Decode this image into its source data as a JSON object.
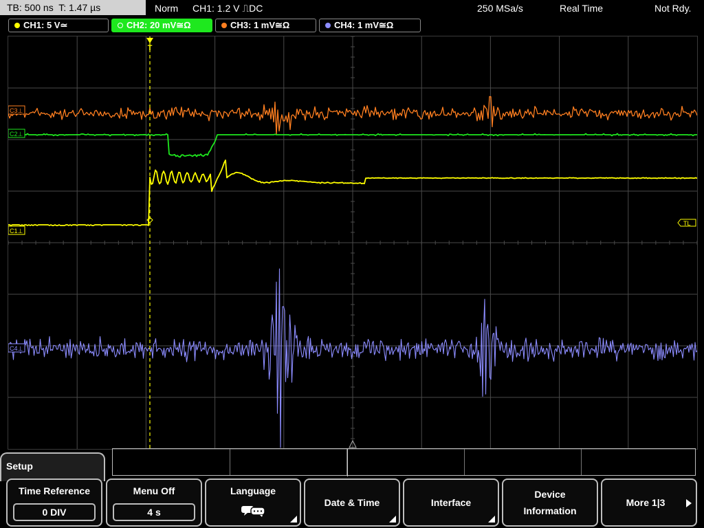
{
  "status_bar": {
    "timebase": "TB: 500 ns  T: 1.47 µs",
    "trigger_mode": "Norm",
    "trigger_info": "CH1: 1.2 V ⎍DC",
    "sample_rate": "250 MSa/s",
    "acq_mode": "Real Time",
    "trigger_state": "Not Rdy."
  },
  "channels": [
    {
      "label": "CH1: 5 V≃",
      "color": "#ffff00",
      "active": false
    },
    {
      "label": "CH2: 20 mV≅Ω",
      "color": "#1ee81e",
      "active": true
    },
    {
      "label": "CH3: 1 mV≅Ω",
      "color": "#ff7f20",
      "active": false
    },
    {
      "label": "CH4: 1 mV≅Ω",
      "color": "#8c8cff",
      "active": false
    }
  ],
  "screen": {
    "markers": {
      "ch1": "C1⊥",
      "ch2": "C2⊥",
      "ch3": "C3⊥",
      "ch4": "C4⊥",
      "trigger_level": "TL",
      "trigger_pos": "T"
    },
    "colors": {
      "grid": "#4a4a4a",
      "ch1": "#ffff00",
      "ch2": "#1ee81e",
      "ch3": "#ff7f20",
      "ch4": "#8c8cff"
    }
  },
  "setup_tab": "Setup",
  "softkeys": {
    "time_reference": {
      "title": "Time Reference",
      "value": "0 DIV"
    },
    "menu_off": {
      "title": "Menu Off",
      "value": "4 s"
    },
    "language": {
      "title": "Language",
      "icon": "speech-bubbles-icon"
    },
    "date_time": {
      "title": "Date & Time"
    },
    "interface": {
      "title": "Interface"
    },
    "device_information": {
      "line1": "Device",
      "line2": "Information"
    },
    "more": {
      "title": "More 1|3"
    }
  }
}
